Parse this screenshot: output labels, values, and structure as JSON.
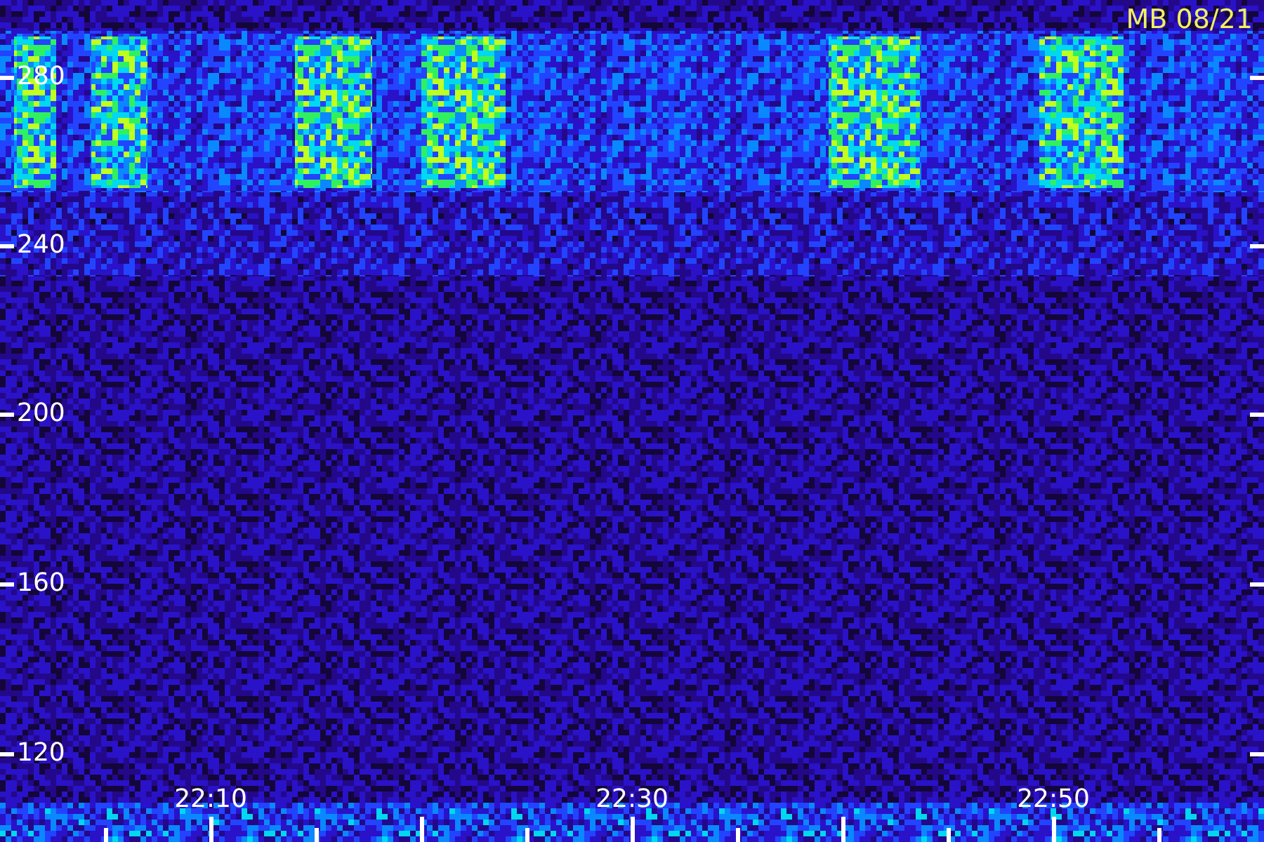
{
  "title": "MB 08/21",
  "y_axis": {
    "ticks": [
      "280",
      "240",
      "200",
      "160",
      "120"
    ]
  },
  "x_axis": {
    "ticks": [
      "22:10",
      "22:30",
      "22:50"
    ]
  }
}
